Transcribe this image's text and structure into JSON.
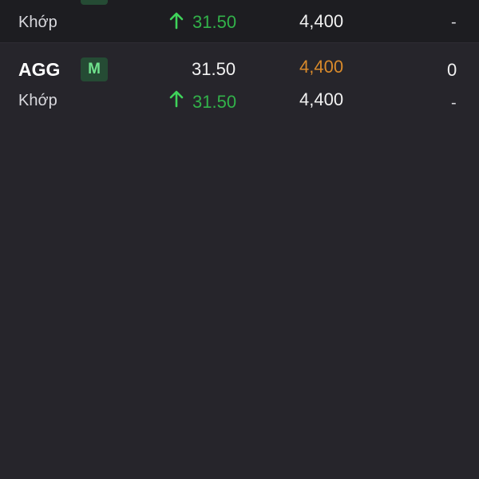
{
  "rows": [
    {
      "symbol": "",
      "badge": "M",
      "match_label": "Khớp",
      "match_price": "31.50",
      "match_volume": "4,400",
      "match_extra": "-"
    },
    {
      "symbol": "AGG",
      "badge": "M",
      "price": "31.50",
      "volume": "4,400",
      "value": "0",
      "match_label": "Khớp",
      "match_price": "31.50",
      "match_volume": "4,400",
      "match_extra": "-"
    }
  ],
  "colors": {
    "background": "#26252b",
    "header_row_bg": "#1d1d21",
    "up_green": "#32b24a",
    "arrow_green": "#3fd35a",
    "orange": "#d98a2b",
    "badge_bg": "#254b34",
    "badge_text": "#6fe28c"
  },
  "icons": {
    "trend": "arrow-up-icon"
  }
}
